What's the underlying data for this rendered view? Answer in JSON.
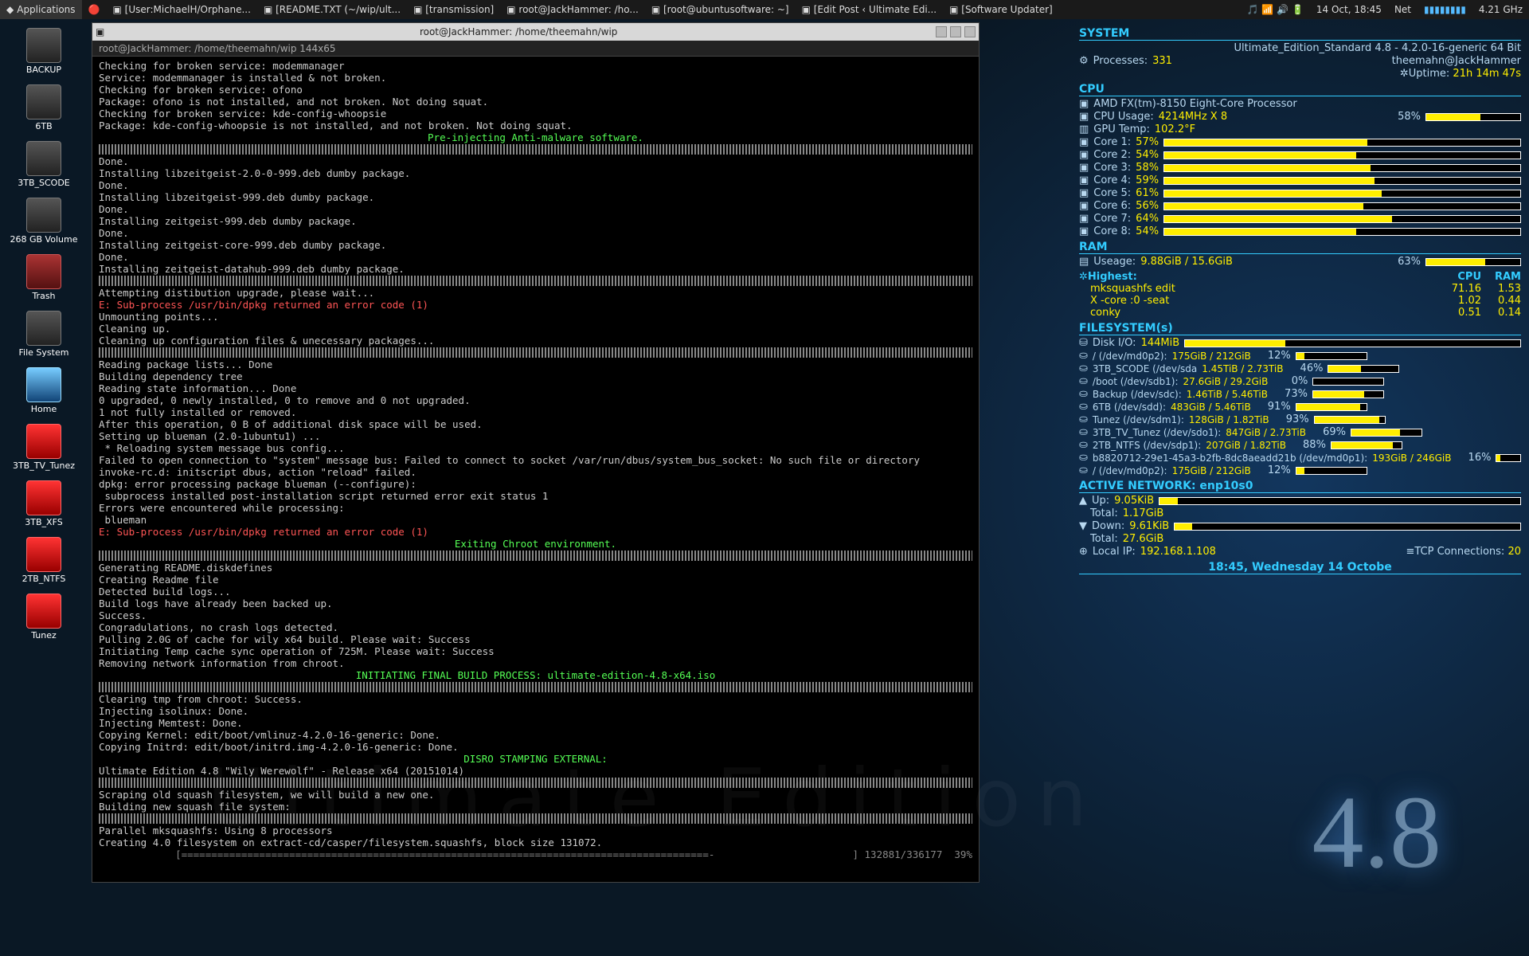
{
  "taskbar": {
    "apps": "Applications",
    "items": [
      "[User:MichaelH/Orphane...",
      "[README.TXT (~/wip/ult...",
      "[transmission]",
      "root@JackHammer: /ho...",
      "[root@ubuntusoftware: ~]",
      "[Edit Post ‹ Ultimate Edi...",
      "[Software Updater]"
    ],
    "clock": "14 Oct, 18:45",
    "net": "Net",
    "freq": "4.21 GHz"
  },
  "desktop": [
    {
      "label": "BACKUP",
      "cls": "hdd"
    },
    {
      "label": "6TB",
      "cls": "hdd"
    },
    {
      "label": "3TB_SCODE",
      "cls": "hdd"
    },
    {
      "label": "268 GB Volume",
      "cls": "hdd"
    },
    {
      "label": "Trash",
      "cls": "trash"
    },
    {
      "label": "File System",
      "cls": "hdd"
    },
    {
      "label": "Home",
      "cls": "home"
    },
    {
      "label": "3TB_TV_Tunez",
      "cls": "usb"
    },
    {
      "label": "3TB_XFS",
      "cls": "usb"
    },
    {
      "label": "2TB_NTFS",
      "cls": "usb"
    },
    {
      "label": "Tunez",
      "cls": "usb"
    }
  ],
  "terminal": {
    "title": "root@JackHammer: /home/theemahn/wip",
    "tab": "root@JackHammer: /home/theemahn/wip 144x65",
    "lines": [
      {
        "t": "Checking for broken service: modemmanager"
      },
      {
        "t": "Service: modemmanager is installed & not broken."
      },
      {
        "t": "Checking for broken service: ofono"
      },
      {
        "t": "Package: ofono is not installed, and not broken. Not doing squat."
      },
      {
        "t": "Checking for broken service: kde-config-whoopsie"
      },
      {
        "t": "Package: kde-config-whoopsie is not installed, and not broken. Not doing squat."
      },
      {
        "t": "Pre-injecting Anti-malware software.",
        "c": "hl"
      },
      {
        "t": "",
        "c": "hr"
      },
      {
        "t": "Done."
      },
      {
        "t": "Installing libzeitgeist-2.0-0-999.deb dumby package."
      },
      {
        "t": "Done."
      },
      {
        "t": "Installing libzeitgeist-999.deb dumby package."
      },
      {
        "t": "Done."
      },
      {
        "t": "Installing zeitgeist-999.deb dumby package."
      },
      {
        "t": "Done."
      },
      {
        "t": "Installing zeitgeist-core-999.deb dumby package."
      },
      {
        "t": "Done."
      },
      {
        "t": "Installing zeitgeist-datahub-999.deb dumby package."
      },
      {
        "t": "",
        "c": "hr"
      },
      {
        "t": "Attempting distibution upgrade, please wait..."
      },
      {
        "t": "E: Sub-process /usr/bin/dpkg returned an error code (1)",
        "c": "err"
      },
      {
        "t": "Unmounting points..."
      },
      {
        "t": "Cleaning up."
      },
      {
        "t": "Cleaning up configuration files & unecessary packages..."
      },
      {
        "t": "",
        "c": "hr"
      },
      {
        "t": "Reading package lists... Done"
      },
      {
        "t": "Building dependency tree"
      },
      {
        "t": "Reading state information... Done"
      },
      {
        "t": "0 upgraded, 0 newly installed, 0 to remove and 0 not upgraded."
      },
      {
        "t": "1 not fully installed or removed."
      },
      {
        "t": "After this operation, 0 B of additional disk space will be used."
      },
      {
        "t": "Setting up blueman (2.0-1ubuntu1) ..."
      },
      {
        "t": " * Reloading system message bus config..."
      },
      {
        "t": "Failed to open connection to \"system\" message bus: Failed to connect to socket /var/run/dbus/system_bus_socket: No such file or directory"
      },
      {
        "t": "invoke-rc.d: initscript dbus, action \"reload\" failed."
      },
      {
        "t": "dpkg: error processing package blueman (--configure):"
      },
      {
        "t": " subprocess installed post-installation script returned error exit status 1"
      },
      {
        "t": "Errors were encountered while processing:"
      },
      {
        "t": " blueman"
      },
      {
        "t": "E: Sub-process /usr/bin/dpkg returned an error code (1)",
        "c": "err"
      },
      {
        "t": "Exiting Chroot environment.",
        "c": "hl"
      },
      {
        "t": "",
        "c": "hr"
      },
      {
        "t": "Generating README.diskdefines"
      },
      {
        "t": "Creating Readme file"
      },
      {
        "t": "Detected build logs..."
      },
      {
        "t": "Build logs have already been backed up."
      },
      {
        "t": "Success."
      },
      {
        "t": "Congradulations, no crash logs detected."
      },
      {
        "t": "Pulling 2.0G of cache for wily x64 build. Please wait: Success"
      },
      {
        "t": "Initiating Temp cache sync operation of 725M. Please wait: Success"
      },
      {
        "t": "Removing network information from chroot."
      },
      {
        "t": "INITIATING FINAL BUILD PROCESS: ultimate-edition-4.8-x64.iso",
        "c": "hl"
      },
      {
        "t": "",
        "c": "hr"
      },
      {
        "t": "Clearing tmp from chroot: Success."
      },
      {
        "t": "Injecting isolinux: Done."
      },
      {
        "t": "Injecting Memtest: Done."
      },
      {
        "t": "Copying Kernel: edit/boot/vmlinuz-4.2.0-16-generic: Done."
      },
      {
        "t": "Copying Initrd: edit/boot/initrd.img-4.2.0-16-generic: Done."
      },
      {
        "t": "DISRO STAMPING EXTERNAL:",
        "c": "hl"
      },
      {
        "t": "Ultimate Edition 4.8 \"Wily Werewolf\" - Release x64 (20151014)"
      },
      {
        "t": "",
        "c": "hr"
      },
      {
        "t": "Scraping old squash filesystem, we will build a new one."
      },
      {
        "t": "Building new squash file system:"
      },
      {
        "t": "",
        "c": "hr"
      },
      {
        "t": "Parallel mksquashfs: Using 8 processors"
      },
      {
        "t": "Creating 4.0 filesystem on extract-cd/casper/filesystem.squashfs, block size 131072."
      },
      {
        "t": "[========================================================================================-                       ] 132881/336177  39%",
        "c": "stat"
      }
    ]
  },
  "conky": {
    "system_h": "SYSTEM",
    "title": "Ultimate_Edition_Standard 4.8 - 4.2.0-16-generic 64 Bit",
    "host": "theemahn@JackHammer",
    "procs_l": "Processes:",
    "procs_v": "331",
    "uptime_l": "Uptime:",
    "uptime_v": "21h 14m 47s",
    "cpu_h": "CPU",
    "cpu_name": "AMD FX(tm)-8150 Eight-Core Processor",
    "cpu_usage_l": "CPU Usage:",
    "cpu_usage_v": "4214MHz X 8",
    "cpu_usage_p": "58%",
    "gpu_l": "GPU Temp:",
    "gpu_v": "102.2°F",
    "cores": [
      {
        "l": "Core 1:",
        "p": 57
      },
      {
        "l": "Core 2:",
        "p": 54
      },
      {
        "l": "Core 3:",
        "p": 58
      },
      {
        "l": "Core 4:",
        "p": 59
      },
      {
        "l": "Core 5:",
        "p": 61
      },
      {
        "l": "Core 6:",
        "p": 56
      },
      {
        "l": "Core 7:",
        "p": 64
      },
      {
        "l": "Core 8:",
        "p": 54
      }
    ],
    "ram_h": "RAM",
    "ram_usage_l": "Useage:",
    "ram_usage_v": "9.88GiB / 15.6GiB",
    "ram_usage_p": "63%",
    "highest_l": "Highest:",
    "highest_c": "CPU",
    "highest_r": "RAM",
    "procs_list": [
      {
        "n": "mksquashfs edit",
        "c": "71.16",
        "r": "1.53"
      },
      {
        "n": "X -core :0 -seat",
        "c": "1.02",
        "r": "0.44"
      },
      {
        "n": "conky",
        "c": "0.51",
        "r": "0.14"
      }
    ],
    "fs_h": "FILESYSTEM(s)",
    "diskio_l": "Disk I/O:",
    "diskio_v": "144MiB",
    "fs": [
      {
        "n": "/ (/dev/md0p2):",
        "v": "175GiB / 212GiB",
        "p": 12
      },
      {
        "n": "3TB_SCODE (/dev/sda ",
        "v": "1.45TiB / 2.73TiB",
        "p": 46
      },
      {
        "n": "/boot (/dev/sdb1):",
        "v": "27.6GiB / 29.2GiB",
        "p": 0
      },
      {
        "n": "Backup (/dev/sdc):",
        "v": "1.46TiB / 5.46TiB",
        "p": 73
      },
      {
        "n": "6TB (/dev/sdd):",
        "v": "483GiB / 5.46TiB",
        "p": 91
      },
      {
        "n": "Tunez (/dev/sdm1):",
        "v": "128GiB / 1.82TiB",
        "p": 93
      },
      {
        "n": "3TB_TV_Tunez (/dev/sdo1):",
        "v": "847GiB / 2.73TiB",
        "p": 69
      },
      {
        "n": "2TB_NTFS (/dev/sdp1):",
        "v": "207GiB / 1.82TiB",
        "p": 88
      },
      {
        "n": "b8820712-29e1-45a3-b2fb-8dc8aeadd21b (/dev/md0p1):",
        "v": "193GiB / 246GiB",
        "p": 16
      },
      {
        "n": "/ (/dev/md0p2):",
        "v": "175GiB / 212GiB",
        "p": 12
      }
    ],
    "net_h": "ACTIVE NETWORK: enp10s0",
    "up_l": "Up:",
    "up_v": "9.05KiB",
    "up_t_l": "Total:",
    "up_t_v": "1.17GiB",
    "dn_l": "Down:",
    "dn_v": "9.61KiB",
    "dn_t_l": "Total:",
    "dn_t_v": "27.6GiB",
    "ip_l": "Local IP:",
    "ip_v": "192.168.1.108",
    "tcp_l": "TCP Connections:",
    "tcp_v": "20",
    "date": "18:45, Wednesday 14 Octobe"
  },
  "brand": "4.8",
  "watermark": "Ultimate Edition"
}
